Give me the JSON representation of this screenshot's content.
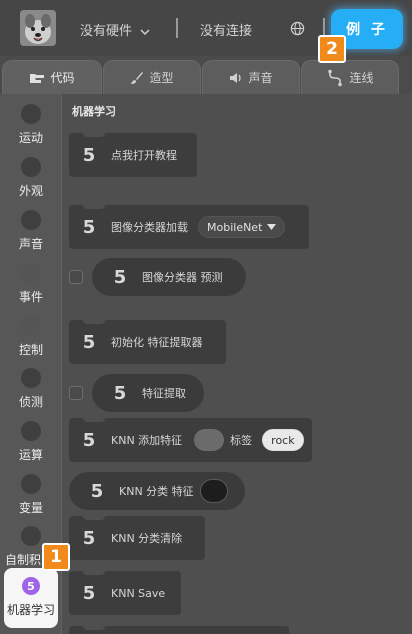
{
  "topbar": {
    "hardware_label": "没有硬件",
    "connection_label": "没有连接",
    "example_button": "例 子"
  },
  "tabs": [
    {
      "label": "代码",
      "icon": "code-icon",
      "active": true
    },
    {
      "label": "造型",
      "icon": "brush-icon",
      "active": false
    },
    {
      "label": "声音",
      "icon": "speaker-icon",
      "active": false
    },
    {
      "label": "连线",
      "icon": "wire-icon",
      "active": false
    }
  ],
  "categories": [
    {
      "label": "运动"
    },
    {
      "label": "外观"
    },
    {
      "label": "声音"
    },
    {
      "label": "事件"
    },
    {
      "label": "控制"
    },
    {
      "label": "侦测"
    },
    {
      "label": "运算"
    },
    {
      "label": "变量"
    },
    {
      "label": "自制积"
    },
    {
      "label": "机器学习",
      "badge": "5",
      "selected": true
    }
  ],
  "palette": {
    "section_title": "机器学习",
    "blocks": [
      {
        "icon": "5",
        "text": "点我打开教程"
      },
      {
        "icon": "5",
        "text": "图像分类器加载",
        "dropdown": "MobileNet"
      },
      {
        "icon": "5",
        "text": "图像分类器 预测"
      },
      {
        "icon": "5",
        "text": "初始化 特征提取器"
      },
      {
        "icon": "5",
        "text": "特征提取"
      },
      {
        "icon": "5",
        "text": "KNN 添加特征",
        "text2": "标签",
        "input": "rock"
      },
      {
        "icon": "5",
        "text": "KNN 分类 特征"
      },
      {
        "icon": "5",
        "text": "KNN 分类清除"
      },
      {
        "icon": "5",
        "text": "KNN Save"
      }
    ]
  },
  "markers": [
    "1",
    "2"
  ],
  "colors": {
    "accent": "#25aef5",
    "marker": "#f08a1a",
    "ml_category": "#9f64e8"
  }
}
